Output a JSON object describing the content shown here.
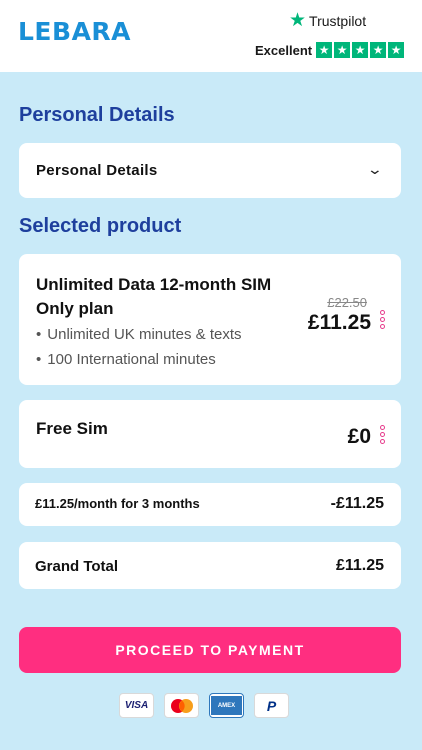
{
  "header": {
    "logo": "LEBARA",
    "trustpilot": {
      "name": "Trustpilot",
      "rating_label": "Excellent",
      "stars": 5,
      "color": "#00b67a"
    }
  },
  "personal_details": {
    "section_title": "Personal Details",
    "accordion_label": "Personal Details"
  },
  "selected_product": {
    "section_title": "Selected product",
    "plan": {
      "title": "Unlimited Data 12-month SIM Only plan",
      "features": [
        "Unlimited UK minutes & texts",
        "100 International minutes"
      ],
      "old_price": "£22.50",
      "price": "£11.25"
    },
    "sim": {
      "title": "Free Sim",
      "price": "£0"
    }
  },
  "promotion": {
    "label": "£11.25/month for 3 months",
    "value": "-£11.25"
  },
  "grand_total": {
    "label": "Grand Total",
    "value": "£11.25"
  },
  "cta": {
    "label": "PROCEED TO PAYMENT",
    "color": "#ff2e80"
  },
  "payment_methods": [
    {
      "name": "visa-icon",
      "label": "VISA"
    },
    {
      "name": "mastercard-icon"
    },
    {
      "name": "amex-icon",
      "label": "AMEX"
    },
    {
      "name": "paypal-icon",
      "label": "P"
    }
  ],
  "colors": {
    "background": "#c9eaf8",
    "heading": "#1e3f9d",
    "brand": "#1a8fd6"
  }
}
